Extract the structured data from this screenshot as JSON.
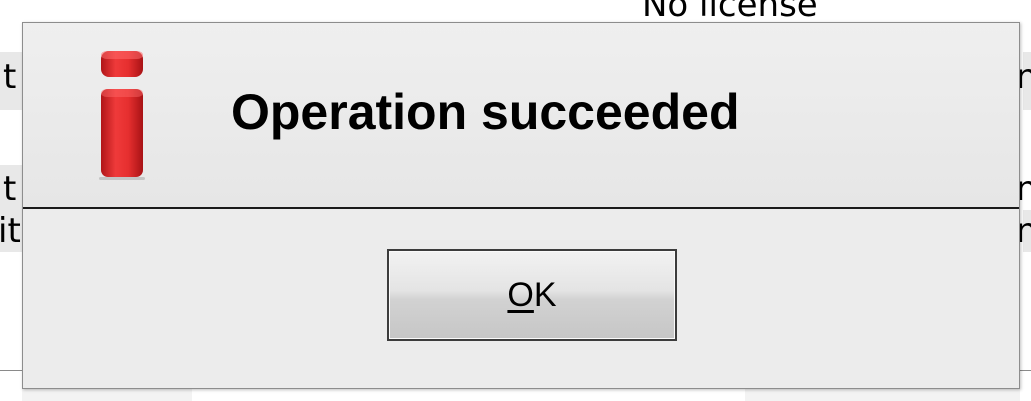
{
  "background_app": {
    "header_fragment": "No license",
    "left_row_fragments": [
      "t",
      "t",
      "it"
    ],
    "right_row_fragments": [
      "n",
      "n",
      "n"
    ]
  },
  "dialog": {
    "icon": "info-icon",
    "message": "Operation succeeded",
    "ok_button": {
      "label": "OK",
      "mnemonic": "O",
      "label_rest": "K"
    }
  },
  "colors": {
    "dialog_background": "#ececec",
    "icon_red": "#e0282a",
    "separator": "#1a1a1a"
  }
}
